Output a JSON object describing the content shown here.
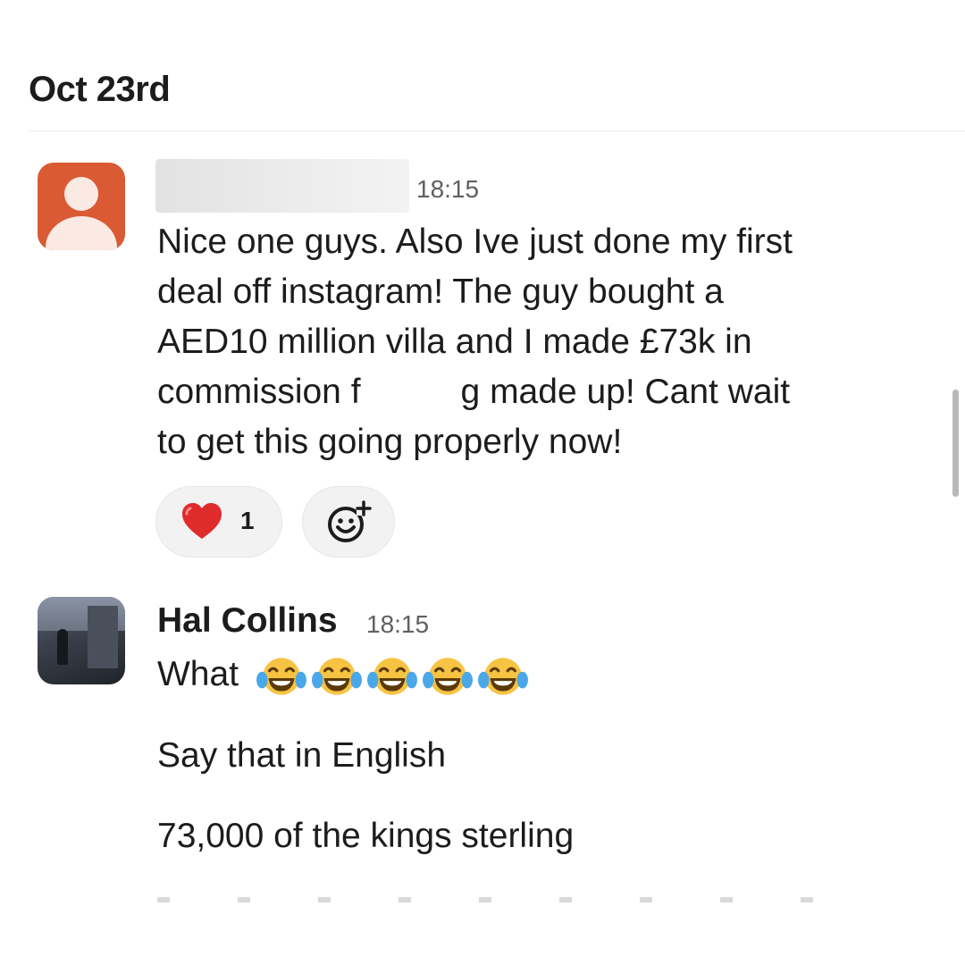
{
  "date_header": "Oct 23rd",
  "messages": [
    {
      "sender": "",
      "timestamp": "18:15",
      "lines": [
        "Nice one guys. Also Ive just done my first",
        "deal off instagram! The guy bought a",
        "AED10 million villa and I made £73k in",
        "commission f",
        "g made up! Cant wait",
        "to get this going properly now!"
      ],
      "reactions": [
        {
          "emoji": "heart-emoji",
          "count": "1"
        }
      ],
      "add_reaction_icon": "add-reaction-icon"
    },
    {
      "sender": "Hal Collins",
      "timestamp": "18:15",
      "lines": [
        "What",
        "Say that in English",
        "73,000 of the kings sterling"
      ],
      "emoji": "face-with-tears-of-joy-emoji",
      "emoji_count": 5
    }
  ],
  "colors": {
    "default_avatar": "#d95a33",
    "reaction_bg": "#f2f2f2",
    "timestamp": "#616061",
    "text": "#1d1c1d"
  }
}
